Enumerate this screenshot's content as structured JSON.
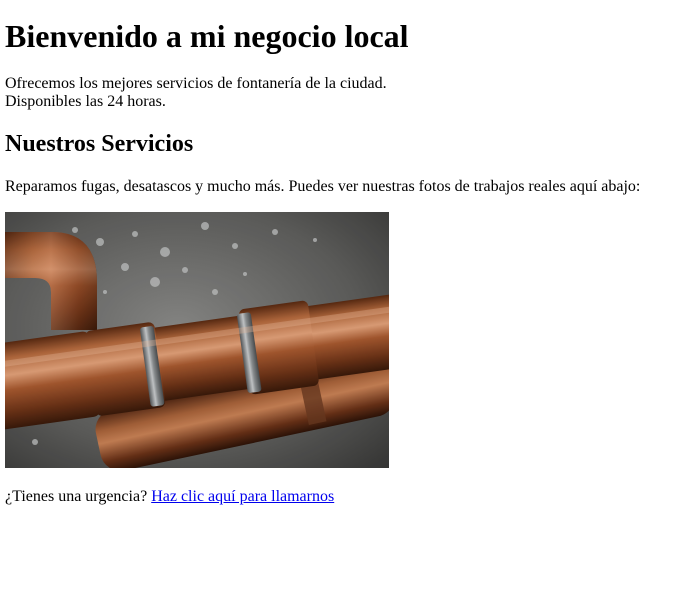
{
  "header": {
    "title": "Bienvenido a mi negocio local"
  },
  "intro": {
    "line1": "Ofrecemos los mejores servicios de fontanería de la ciudad.",
    "line2": "Disponibles las 24 horas."
  },
  "services": {
    "heading": "Nuestros Servicios",
    "text": "Reparamos fugas, desatascos y mucho más. Puedes ver nuestras fotos de trabajos reales aquí abajo:"
  },
  "cta": {
    "prompt": "¿Tienes una urgencia?",
    "link_label": "Haz clic aquí para llamarnos"
  },
  "colors": {
    "link": "#0000ee",
    "text": "#000000",
    "background": "#ffffff"
  }
}
